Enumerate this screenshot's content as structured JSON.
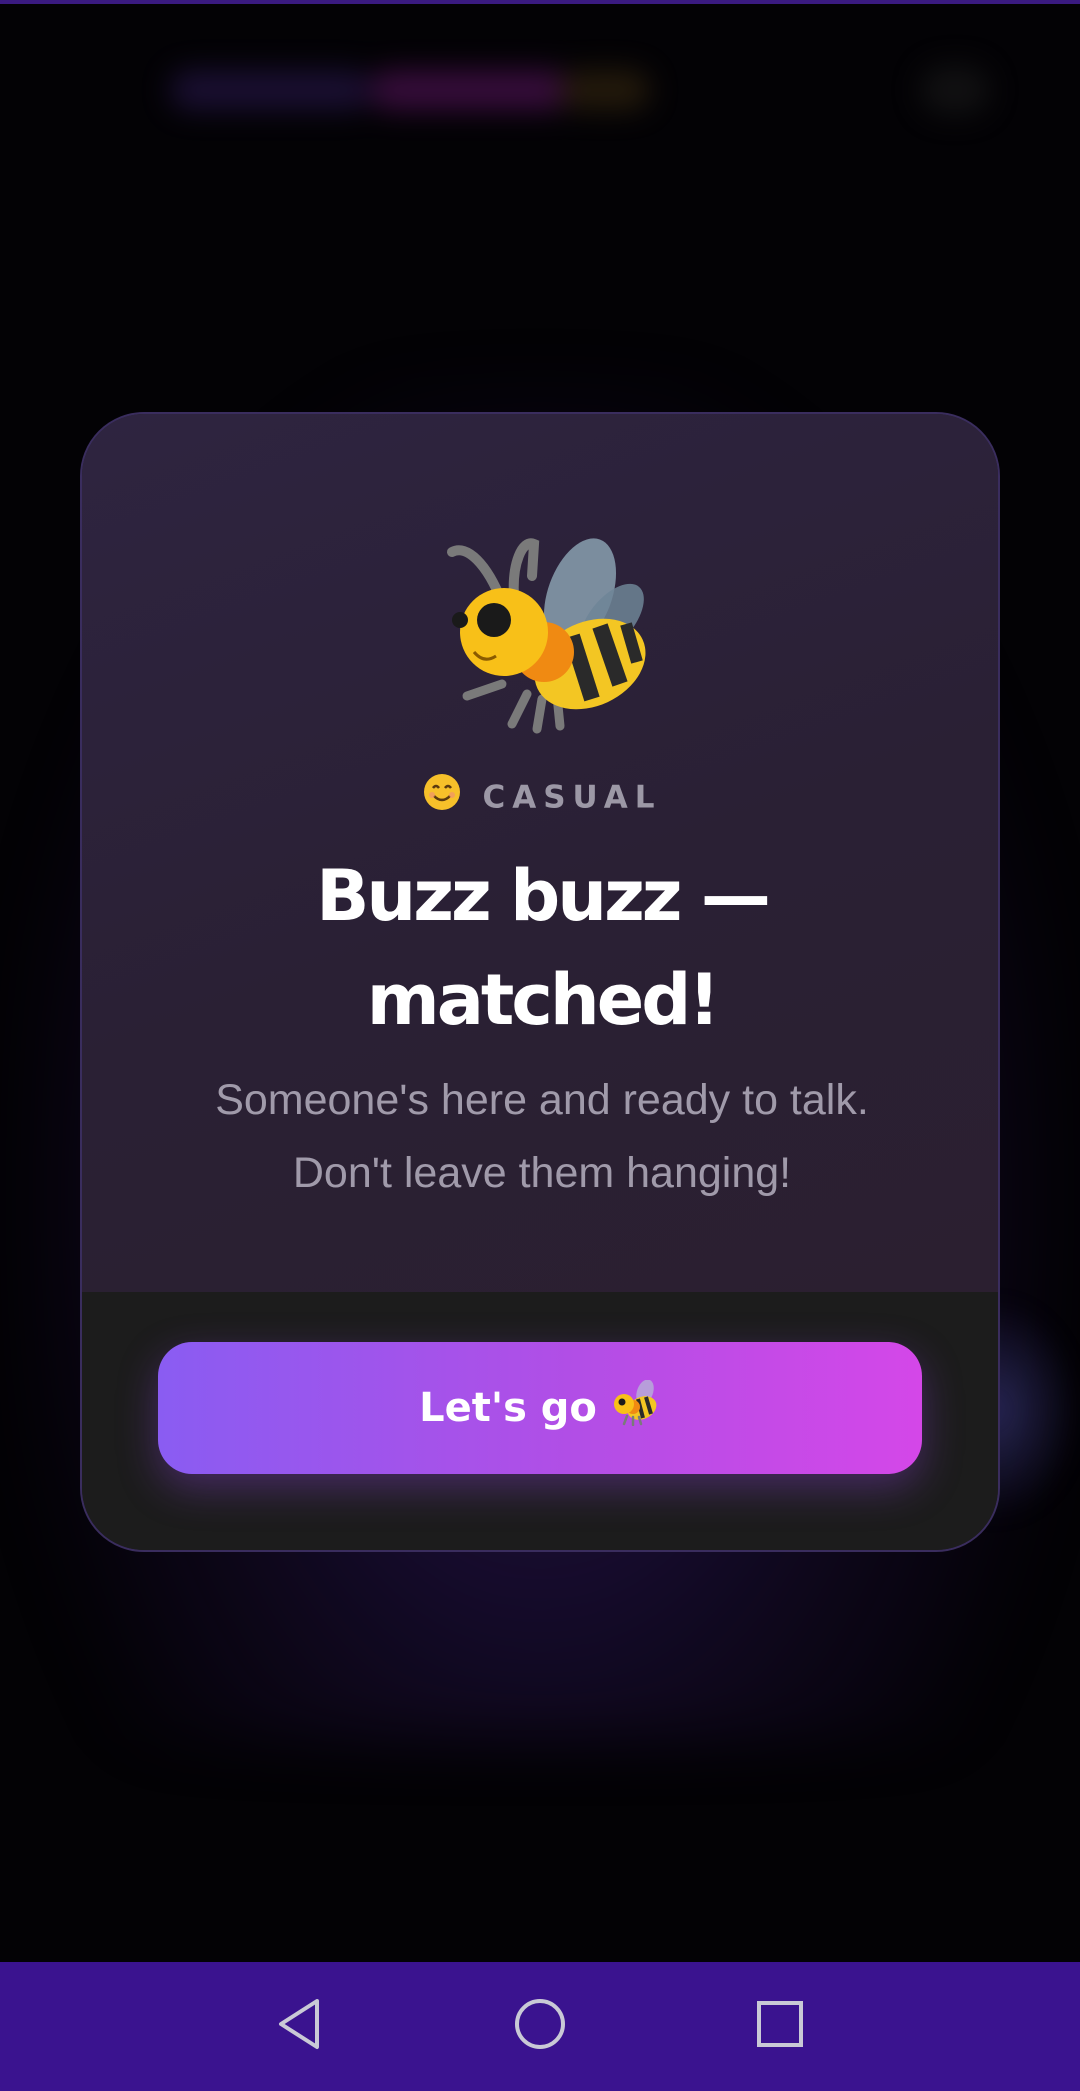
{
  "card": {
    "category_emoji": "😊",
    "category": "CASUAL",
    "title_line1": "Buzz buzz —",
    "title_line2": "matched!",
    "subtitle_line1": "Someone's here and ready to talk.",
    "subtitle_line2": "Don't leave them hanging!",
    "hero_icon": "bee-icon"
  },
  "cta": {
    "label": "Let's go",
    "emoji": "🐝"
  },
  "navbar": {
    "back": "back-icon",
    "home": "home-icon",
    "recents": "recents-icon"
  },
  "colors": {
    "accent_start": "#8a5cf2",
    "accent_end": "#d447e8",
    "navbar": "#3a138f",
    "card_border": "#3a2d5e"
  }
}
